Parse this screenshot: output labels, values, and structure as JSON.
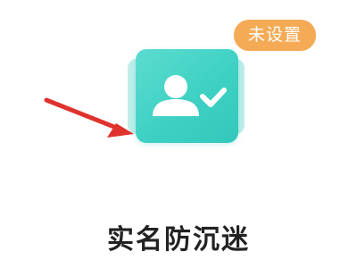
{
  "badge": {
    "status_label": "未设置",
    "color": "#f5ab56"
  },
  "card": {
    "icon_name": "user-verified-icon",
    "color": "#3ed1c3"
  },
  "pointer": {
    "icon_name": "red-arrow-icon",
    "color": "#e0322d"
  },
  "title": {
    "text": "实名防沉迷"
  }
}
